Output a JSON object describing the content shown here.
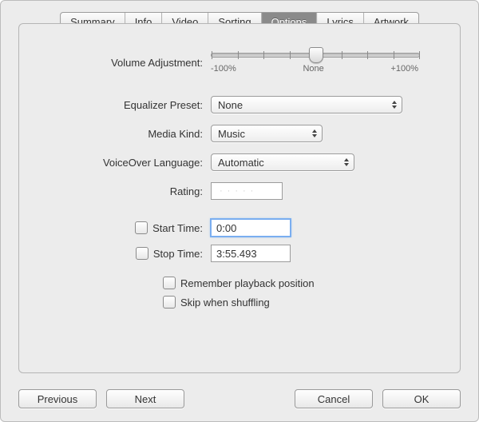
{
  "tabs": [
    "Summary",
    "Info",
    "Video",
    "Sorting",
    "Options",
    "Lyrics",
    "Artwork"
  ],
  "options": {
    "volume_adjustment_label": "Volume Adjustment:",
    "slider": {
      "min_label": "-100%",
      "mid_label": "None",
      "max_label": "+100%"
    },
    "equalizer_label": "Equalizer Preset:",
    "equalizer_value": "None",
    "media_kind_label": "Media Kind:",
    "media_kind_value": "Music",
    "voiceover_label": "VoiceOver Language:",
    "voiceover_value": "Automatic",
    "rating_label": "Rating:",
    "start_time_label": "Start Time:",
    "start_time_value": "0:00",
    "stop_time_label": "Stop Time:",
    "stop_time_value": "3:55.493",
    "remember_label": "Remember playback position",
    "skip_label": "Skip when shuffling"
  },
  "buttons": {
    "previous": "Previous",
    "next": "Next",
    "cancel": "Cancel",
    "ok": "OK"
  }
}
